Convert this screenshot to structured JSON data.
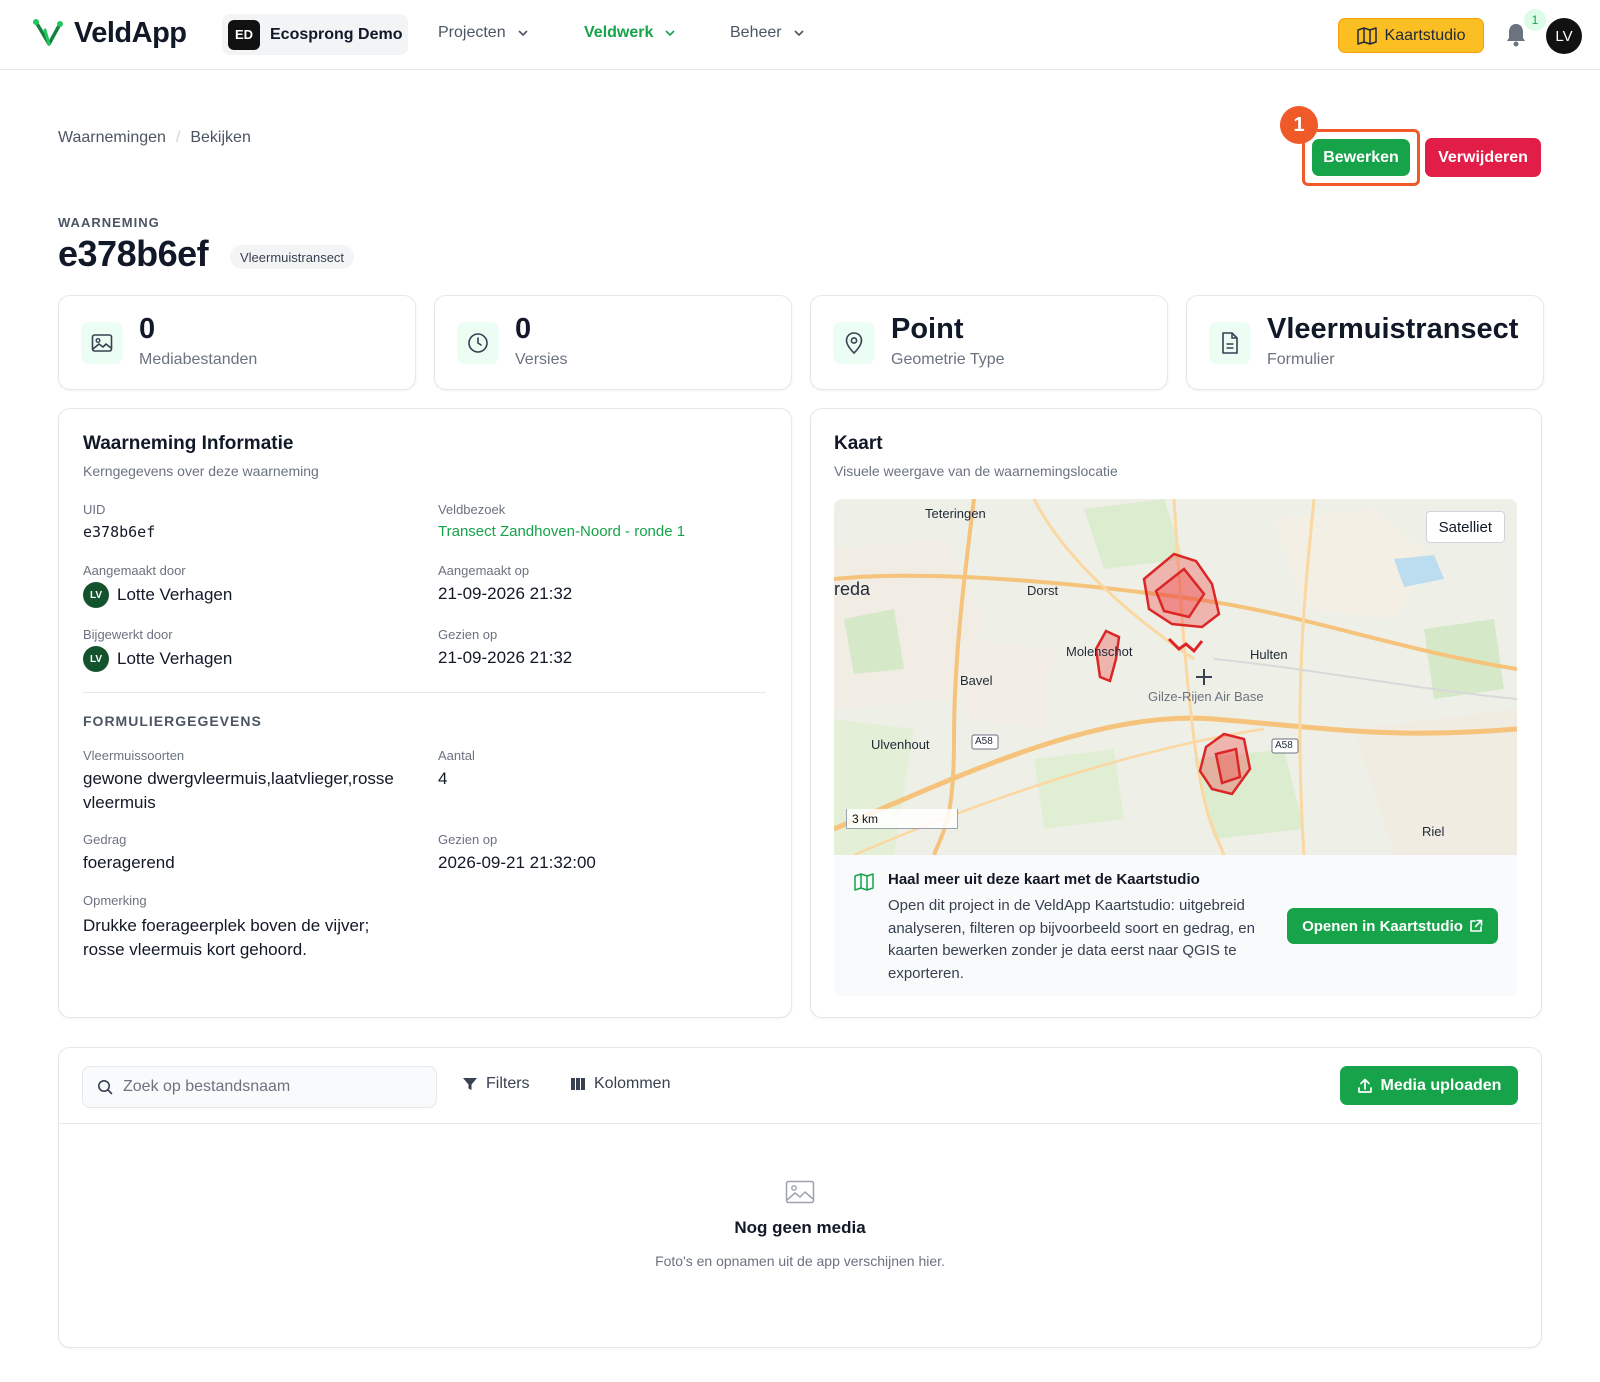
{
  "app": {
    "name": "VeldApp"
  },
  "org": {
    "initials": "ED",
    "name": "Ecosprong Demo"
  },
  "nav": [
    {
      "label": "Projecten"
    },
    {
      "label": "Veldwerk"
    },
    {
      "label": "Beheer"
    }
  ],
  "topbar": {
    "kaartstudio_label": "Kaartstudio",
    "notifications": "1",
    "user_initials": "LV"
  },
  "breadcrumb": {
    "items": [
      "Waarnemingen",
      "Bekijken"
    ],
    "separator": "/"
  },
  "actions": {
    "step": "1",
    "edit": "Bewerken",
    "delete": "Verwijderen"
  },
  "header": {
    "eyebrow": "WAARNEMING",
    "title": "e378b6ef",
    "tag": "Vleermuistransect"
  },
  "stats": [
    {
      "value": "0",
      "label": "Mediabestanden",
      "icon": "image-icon"
    },
    {
      "value": "0",
      "label": "Versies",
      "icon": "clock-icon"
    },
    {
      "value": "Point",
      "label": "Geometrie Type",
      "icon": "map-pin-icon"
    },
    {
      "value": "Vleermuistransect",
      "label": "Formulier",
      "icon": "document-icon"
    }
  ],
  "info": {
    "title": "Waarneming Informatie",
    "subtitle": "Kerngegevens over deze waarneming",
    "uid_label": "UID",
    "uid": "e378b6ef",
    "visit_label": "Veldbezoek",
    "visit": "Transect Zandhoven-Noord - ronde 1",
    "created_by_label": "Aangemaakt door",
    "created_by": "Lotte Verhagen",
    "created_by_initials": "LV",
    "created_at_label": "Aangemaakt op",
    "created_at": "21-09-2026 21:32",
    "updated_by_label": "Bijgewerkt door",
    "updated_by": "Lotte Verhagen",
    "updated_by_initials": "LV",
    "seen_label": "Gezien op",
    "seen": "21-09-2026 21:32"
  },
  "form": {
    "heading": "FORMULIERGEGEVENS",
    "species_label": "Vleermuissoorten",
    "species": "gewone dwergvleermuis,laatvlieger,rosse vleermuis",
    "count_label": "Aantal",
    "count": "4",
    "behaviour_label": "Gedrag",
    "behaviour": "foeragerend",
    "seen_label": "Gezien op",
    "seen": "2026-09-21 21:32:00",
    "remark_label": "Opmerking",
    "remark": "Drukke foerageerplek boven de vijver; rosse vleermuis kort gehoord."
  },
  "map": {
    "title": "Kaart",
    "subtitle": "Visuele weergave van de waarnemingslocatie",
    "satellite_label": "Satelliet",
    "places": [
      "Teteringen",
      "reda",
      "Dorst",
      "Molenschot",
      "Hulten",
      "Bavel",
      "Gilze-Rijen Air Base",
      "Ulvenhout",
      "Riel"
    ],
    "roads": [
      "A58",
      "A58"
    ],
    "scale": "3 km",
    "promo_title": "Haal meer uit deze kaart met de Kaartstudio",
    "promo_text": "Open dit project in de VeldApp Kaartstudio: uitgebreid analyseren, filteren op bijvoorbeeld soort en gedrag, en kaarten bewerken zonder je data eerst naar QGIS te exporteren.",
    "promo_button": "Openen in Kaartstudio"
  },
  "media": {
    "search_placeholder": "Zoek op bestandsnaam",
    "filters": "Filters",
    "columns": "Kolommen",
    "upload": "Media uploaden",
    "empty_title": "Nog geen media",
    "empty_text": "Foto's en opnamen uit de app verschijnen hier."
  },
  "colors": {
    "primary": "#16a34a",
    "danger": "#e11d48",
    "accent": "#fbbf24",
    "highlight": "#f05a28"
  }
}
